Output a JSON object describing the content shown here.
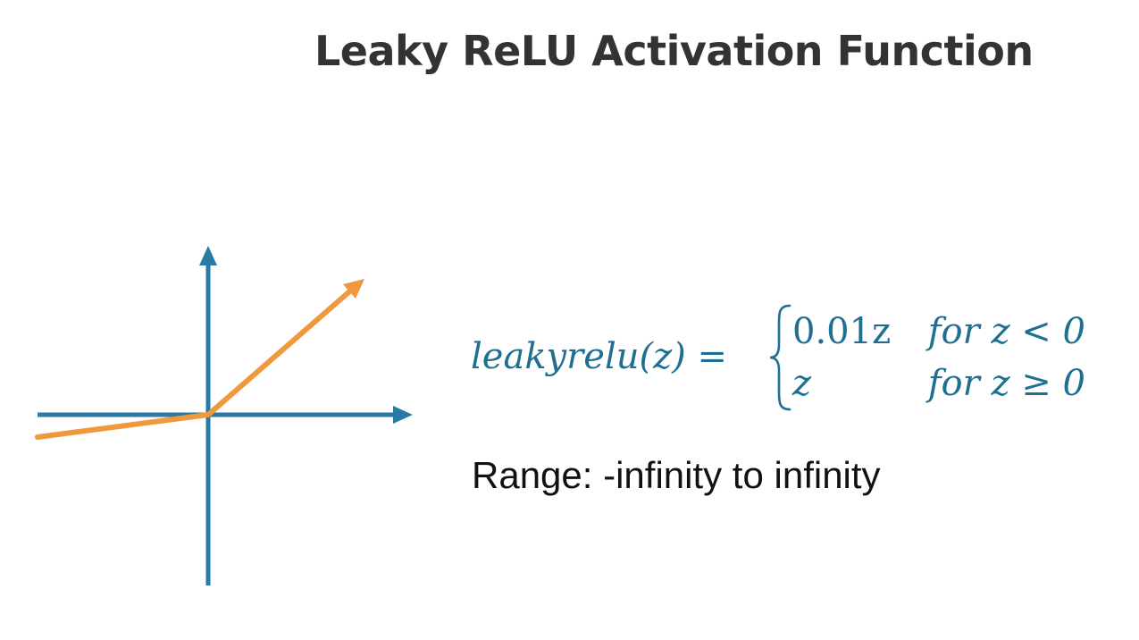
{
  "title": "Leaky ReLU Activation Function",
  "formula": {
    "lhs": "leakyrelu(z) =",
    "cases": [
      {
        "value": "0.01z",
        "condition": "for z < 0"
      },
      {
        "value": "z",
        "condition": "for z ≥ 0"
      }
    ]
  },
  "range_text": "Range: -infinity to infinity",
  "colors": {
    "axis": "#2a7aa6",
    "curve": "#f0983c",
    "formula": "#1f6f93",
    "title": "#333333"
  }
}
